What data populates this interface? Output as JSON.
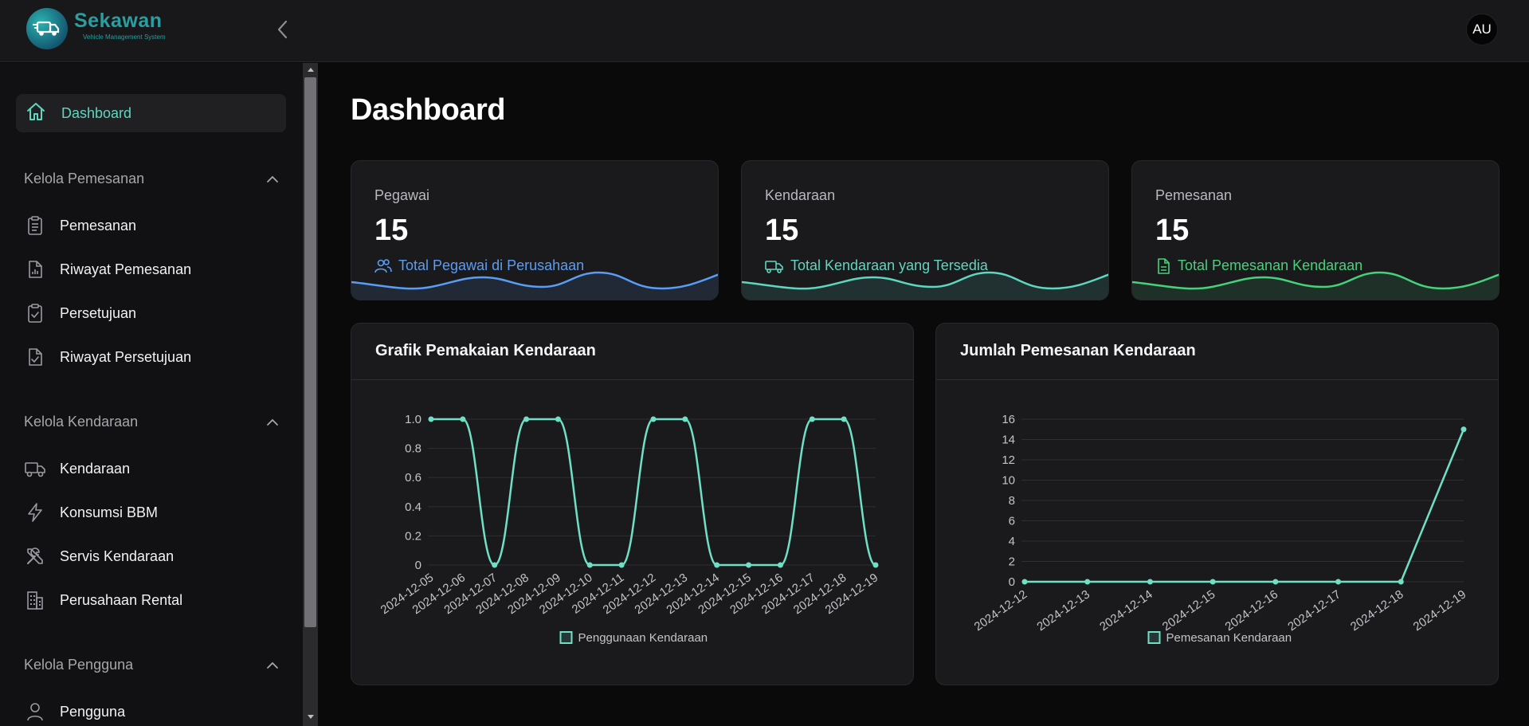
{
  "brand": {
    "title": "Sekawan",
    "subtitle": "Vehicle Management System"
  },
  "user": {
    "initials": "AU"
  },
  "sidebar": {
    "dashboard": {
      "label": "Dashboard",
      "icon": "home-icon"
    },
    "sections": [
      {
        "title": "Kelola Pemesanan",
        "items": [
          {
            "label": "Pemesanan",
            "icon": "clipboard-icon"
          },
          {
            "label": "Riwayat Pemesanan",
            "icon": "file-chart-icon"
          },
          {
            "label": "Persetujuan",
            "icon": "clipboard-check-icon"
          },
          {
            "label": "Riwayat Persetujuan",
            "icon": "file-check-icon"
          }
        ]
      },
      {
        "title": "Kelola Kendaraan",
        "items": [
          {
            "label": "Kendaraan",
            "icon": "truck-icon"
          },
          {
            "label": "Konsumsi BBM",
            "icon": "bolt-icon"
          },
          {
            "label": "Servis Kendaraan",
            "icon": "tools-icon"
          },
          {
            "label": "Perusahaan Rental",
            "icon": "building-icon"
          }
        ]
      },
      {
        "title": "Kelola Pengguna",
        "items": [
          {
            "label": "Pengguna",
            "icon": "user-icon"
          }
        ]
      }
    ]
  },
  "page": {
    "title": "Dashboard"
  },
  "stats": [
    {
      "label": "Pegawai",
      "value": "15",
      "desc": "Total Pegawai di Perusahaan",
      "icon": "users-icon",
      "color": "#5a9df5"
    },
    {
      "label": "Kendaraan",
      "value": "15",
      "desc": "Total Kendaraan yang Tersedia",
      "icon": "truck-icon",
      "color": "#5ed6c0"
    },
    {
      "label": "Pemesanan",
      "value": "15",
      "desc": "Total Pemesanan Kendaraan",
      "icon": "file-icon",
      "color": "#46d27a"
    }
  ],
  "charts": {
    "usage_title": "Grafik Pemakaian Kendaraan",
    "booking_title": "Jumlah Pemesanan Kendaraan"
  },
  "chart_data": [
    {
      "type": "line",
      "title": "Grafik Pemakaian Kendaraan",
      "x": [
        "2024-12-05",
        "2024-12-06",
        "2024-12-07",
        "2024-12-08",
        "2024-12-09",
        "2024-12-10",
        "2024-12-11",
        "2024-12-12",
        "2024-12-13",
        "2024-12-14",
        "2024-12-15",
        "2024-12-16",
        "2024-12-17",
        "2024-12-18",
        "2024-12-19"
      ],
      "series": [
        {
          "name": "Penggunaan Kendaraan",
          "values": [
            1,
            1,
            0,
            1,
            1,
            0,
            0,
            1,
            1,
            0,
            0,
            0,
            1,
            1,
            0
          ]
        }
      ],
      "yticks": [
        "0",
        "0.2",
        "0.4",
        "0.6",
        "0.8",
        "1.0"
      ],
      "ylim": [
        0,
        1
      ],
      "grid": true,
      "legend": "bottom",
      "color": "#6fe0c6"
    },
    {
      "type": "line",
      "title": "Jumlah Pemesanan Kendaraan",
      "x": [
        "2024-12-12",
        "2024-12-13",
        "2024-12-14",
        "2024-12-15",
        "2024-12-16",
        "2024-12-17",
        "2024-12-18",
        "2024-12-19"
      ],
      "series": [
        {
          "name": "Pemesanan Kendaraan",
          "values": [
            0,
            0,
            0,
            0,
            0,
            0,
            0,
            15
          ]
        }
      ],
      "yticks": [
        "0",
        "2",
        "4",
        "6",
        "8",
        "10",
        "12",
        "14",
        "16"
      ],
      "ylim": [
        0,
        16
      ],
      "grid": true,
      "legend": "bottom",
      "color": "#6fe0c6"
    }
  ]
}
